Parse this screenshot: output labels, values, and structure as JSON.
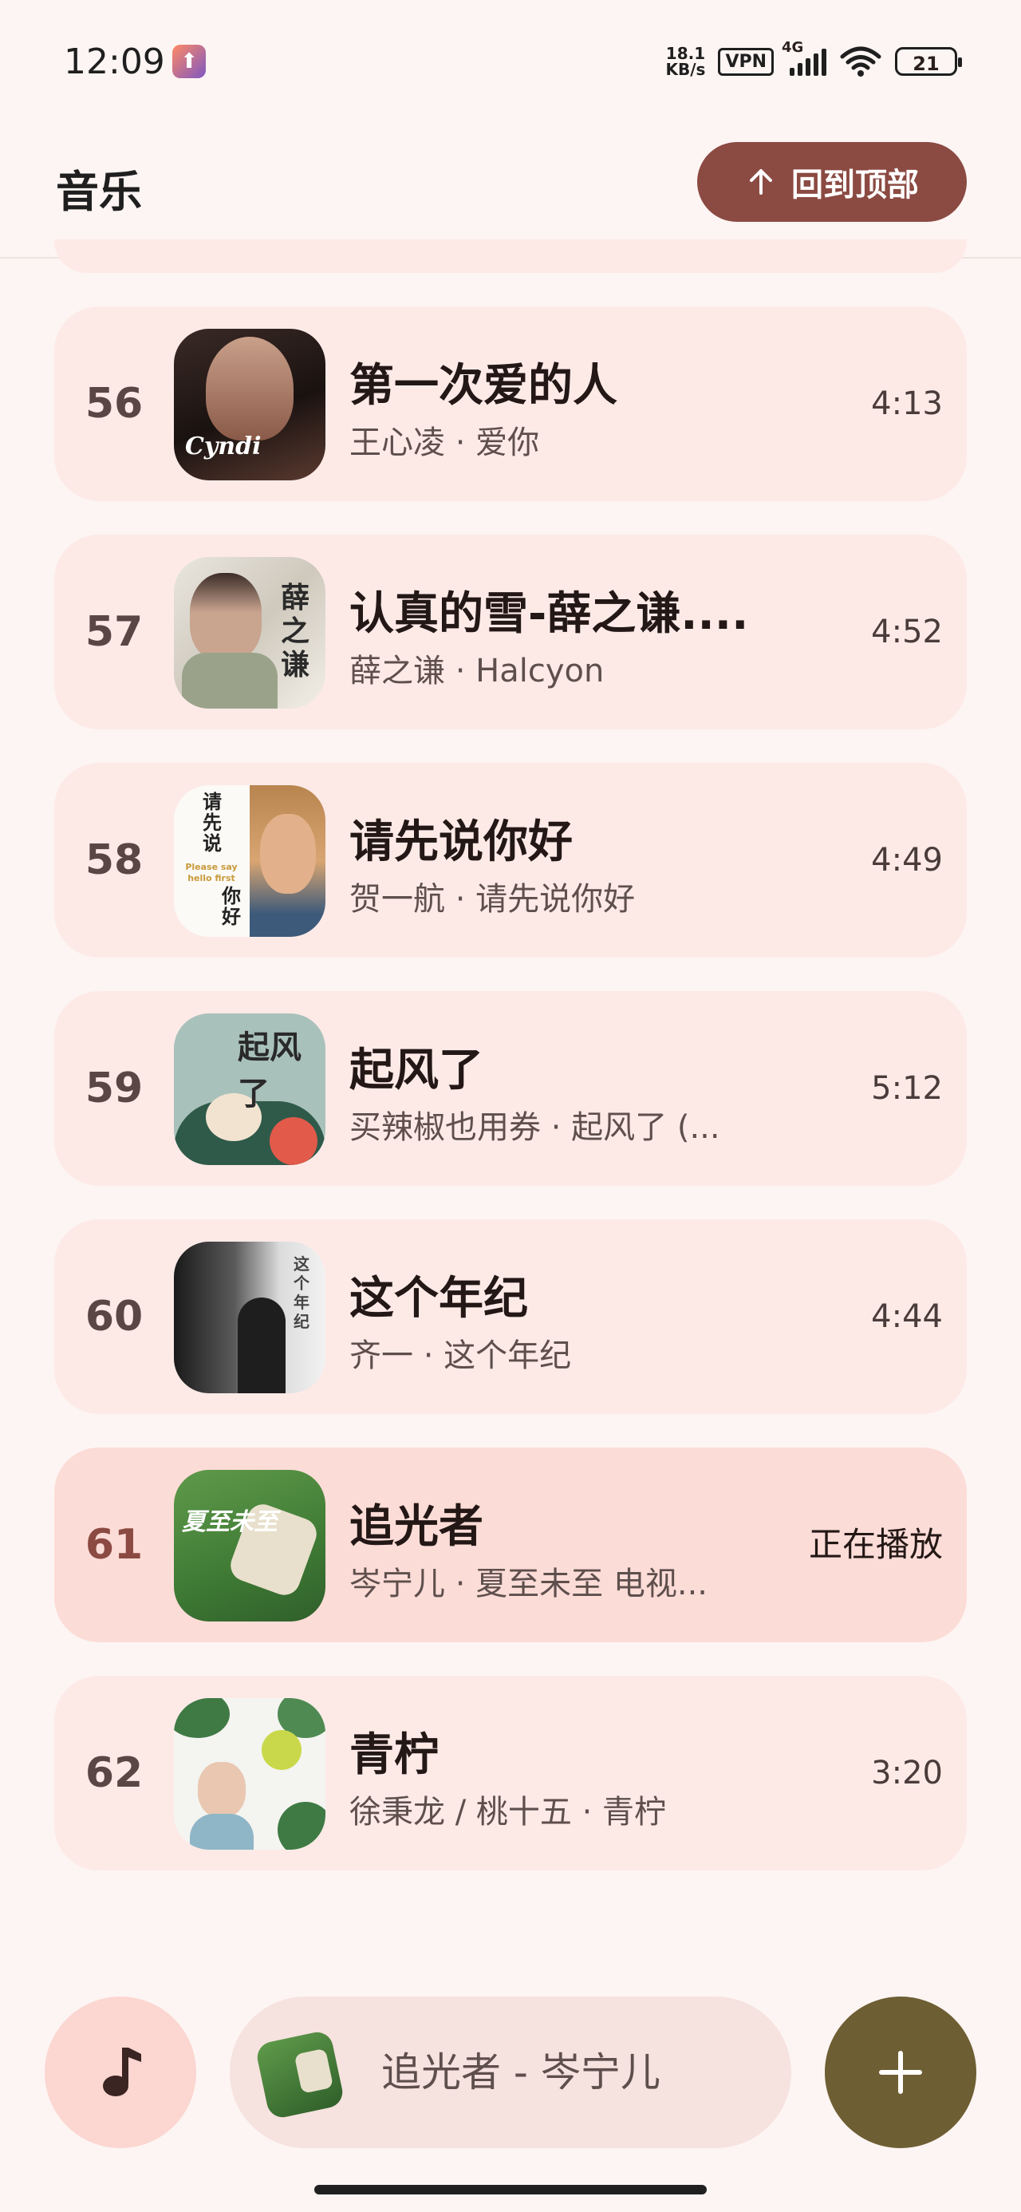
{
  "status_bar": {
    "time": "12:09",
    "net_speed_value": "18.1",
    "net_speed_unit": "KB/s",
    "vpn": "VPN",
    "network_type": "4G",
    "battery": "21"
  },
  "header": {
    "title": "音乐",
    "back_to_top_label": "回到顶部"
  },
  "songs": [
    {
      "index": "56",
      "title": "第一次爱的人",
      "subtitle": "王心凌 · 爱你",
      "duration": "4:13"
    },
    {
      "index": "57",
      "title": "认真的雪-薛之谦....",
      "subtitle": "薛之谦 · Halcyon",
      "duration": "4:52"
    },
    {
      "index": "58",
      "title": "请先说你好",
      "subtitle": "贺一航 · 请先说你好",
      "duration": "4:49"
    },
    {
      "index": "59",
      "title": "起风了",
      "subtitle": "买辣椒也用券 · 起风了 (...",
      "duration": "5:12"
    },
    {
      "index": "60",
      "title": "这个年纪",
      "subtitle": "齐一 · 这个年纪",
      "duration": "4:44"
    },
    {
      "index": "61",
      "title": "追光者",
      "subtitle": "岑宁儿 · 夏至未至 电视...",
      "duration": "正在播放",
      "playing": true
    },
    {
      "index": "62",
      "title": "青柠",
      "subtitle": "徐秉龙 / 桃十五 · 青柠",
      "duration": "3:20"
    }
  ],
  "covers": {
    "c56": "Cyndi",
    "c57": "薛之谦",
    "c58_cn": "请先说",
    "c58_en": "Please say hello first",
    "c58_cn2": "你好",
    "c59": "起风了",
    "c60": "这个年纪",
    "c61": "夏至未至"
  },
  "now_playing": {
    "text": "追光者 - 岑宁儿"
  },
  "colors": {
    "accent": "#8b4a42",
    "card": "#fdeae7",
    "card_playing": "#fcdcd7",
    "add_fab": "#6e5e33",
    "music_fab": "#fcd6d1"
  }
}
